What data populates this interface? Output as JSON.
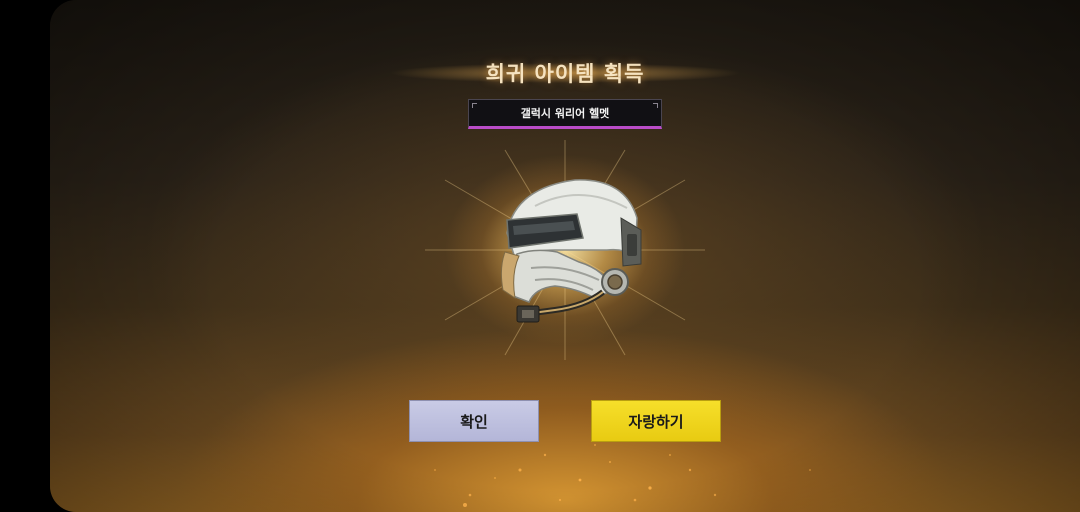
{
  "dialog": {
    "title": "희귀 아이템 획득",
    "item_name": "갤럭시 워리어 헬멧",
    "item_icon": "helmet-icon"
  },
  "buttons": {
    "confirm_label": "확인",
    "share_label": "자랑하기"
  },
  "colors": {
    "confirm_bg": "#c0c2e0",
    "share_bg": "#f0d41e",
    "rarity_accent": "#b94cc8",
    "title_color": "#f6e3c0"
  }
}
